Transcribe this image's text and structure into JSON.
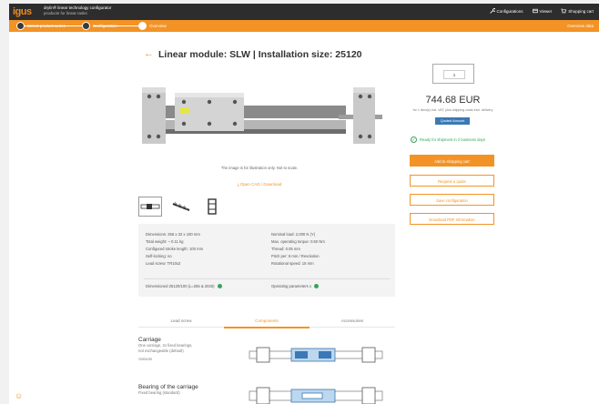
{
  "header": {
    "logo": "igus",
    "brand_title": "drylin® linear technology configurator",
    "brand_subtitle": "products for linear tasks",
    "nav": [
      {
        "label": "Configurations",
        "icon": "wrench-icon"
      },
      {
        "label": "Viewer",
        "icon": "viewer-icon"
      },
      {
        "label": "Shopping cart",
        "icon": "cart-icon"
      }
    ]
  },
  "steps": [
    {
      "label": "Select product series"
    },
    {
      "label": "Configuration"
    },
    {
      "label": "Overview"
    }
  ],
  "steps_overview": "Overview data",
  "page": {
    "title": "Linear module: SLW | Installation size: 25120",
    "image_caption": "The image is for illustration only. Not to scale.",
    "cad_link": "Open CAD / Download"
  },
  "thumbnails": [
    {
      "name": "module-view"
    },
    {
      "name": "drive-view"
    },
    {
      "name": "carriage-view"
    }
  ],
  "specs": {
    "left": [
      "Dimensions:  255 x 32 x 100 mm",
      "Total weight:  ~ 0.11 kg",
      "Configured stroke length:  100 mm",
      "Self-locking:  no",
      "Lead screw:  TR10x2"
    ],
    "right": [
      "Nominal load:  2,000 N (Y)",
      "Max. operating torque:  0.50 Nm",
      "Thread:  0.05 mm",
      "Pitch per:  8 mm / Revolution",
      "Rotational speed:  15 mm"
    ],
    "foot_left": "Dimensioned  25120/100 (L=255 & 2025)",
    "foot_right": "Operating parameters  x"
  },
  "tabs": [
    {
      "label": "Lead screw"
    },
    {
      "label": "Components"
    },
    {
      "label": "Accessories"
    }
  ],
  "active_tab": 1,
  "options": [
    {
      "heading": "Carriage",
      "desc1": "One carriage, 2x fixed bearings,",
      "desc2": "not exchangeable (default)",
      "price": "Variants"
    },
    {
      "heading": "Bearing of the carriage",
      "desc1": "Fixed bearing (standard)"
    }
  ],
  "cart": {
    "quantity": "1",
    "price": "744.68 EUR",
    "price_note": "for 1 item(s) incl. VAT, plus shipping costs excl. delivery",
    "badge": "Quoted Amount",
    "availability": "Ready for shipment in 2 business days",
    "buttons": {
      "add_to_cart": "Add to shopping cart",
      "request_quote": "Request a quote",
      "save_config": "Save configuration",
      "download_pdf": "Download PDF Information"
    }
  },
  "colors": {
    "accent": "#f39325",
    "header_bg": "#2d2d2d",
    "badge": "#3b78b5",
    "available": "#3aa35b"
  }
}
